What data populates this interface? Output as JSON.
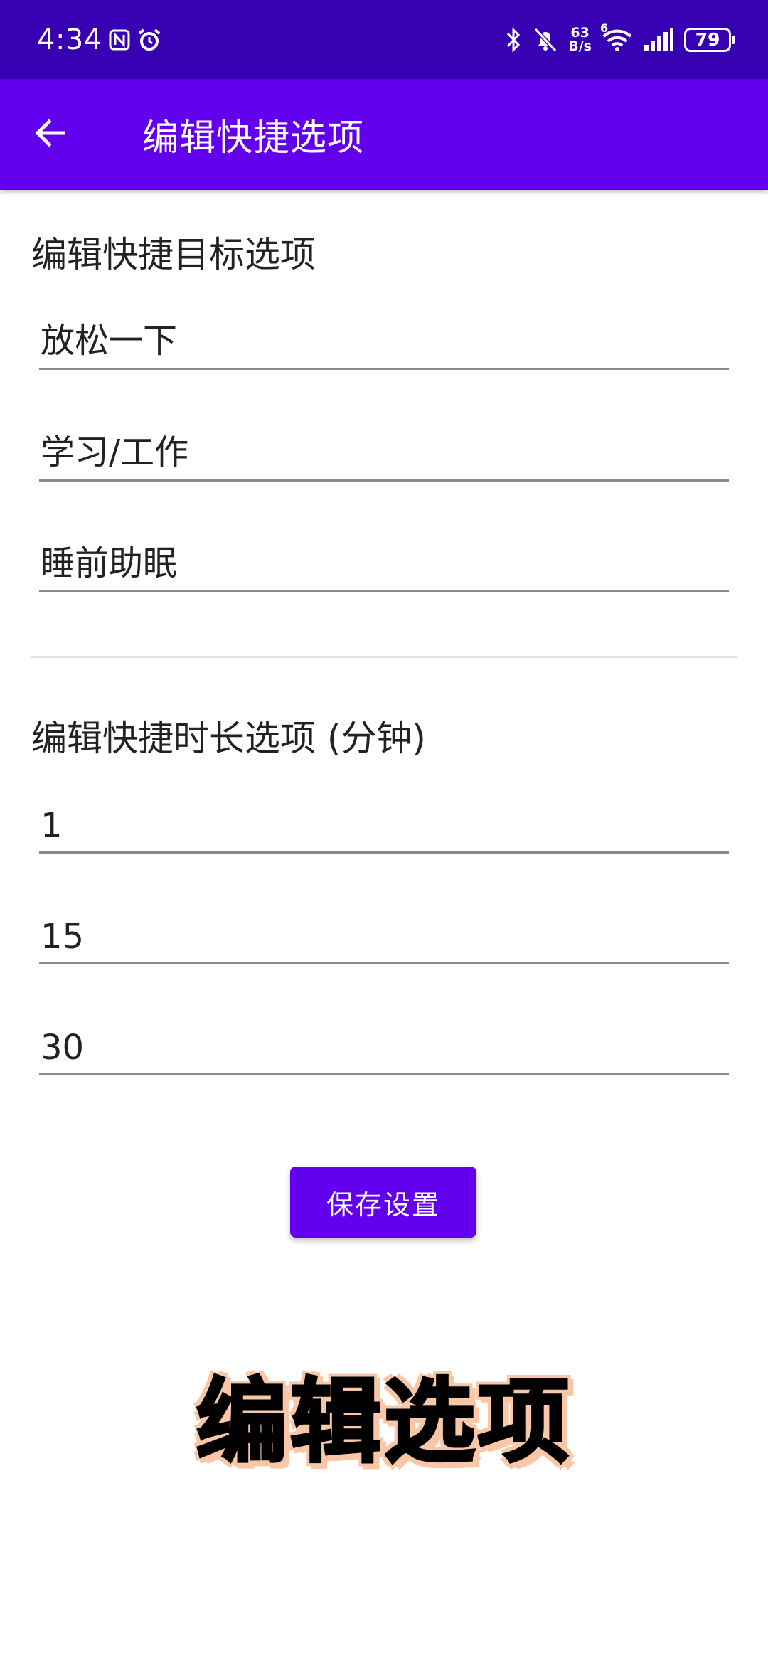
{
  "status_bar": {
    "time": "4:34",
    "speed_value": "63",
    "speed_unit": "B/s",
    "wifi_badge": "6",
    "battery": "79",
    "icons": [
      "nfc-icon",
      "alarm-icon",
      "bluetooth-icon",
      "bell-off-icon",
      "wifi-icon",
      "signal-icon",
      "battery-icon"
    ]
  },
  "app_bar": {
    "title": "编辑快捷选项",
    "back_icon": "arrow-left-icon"
  },
  "goal_section": {
    "title": "编辑快捷目标选项",
    "fields": [
      "放松一下",
      "学习/工作",
      "睡前助眠"
    ]
  },
  "duration_section": {
    "title": "编辑快捷时长选项 (分钟)",
    "fields": [
      "1",
      "15",
      "30"
    ]
  },
  "save_button": {
    "label": "保存设置"
  },
  "overlay_caption": "编辑选项",
  "colors": {
    "status_bar": "#3700b3",
    "app_bar": "#6200ee",
    "button": "#6200ee",
    "caption_shadow": "#f9c7a6"
  }
}
